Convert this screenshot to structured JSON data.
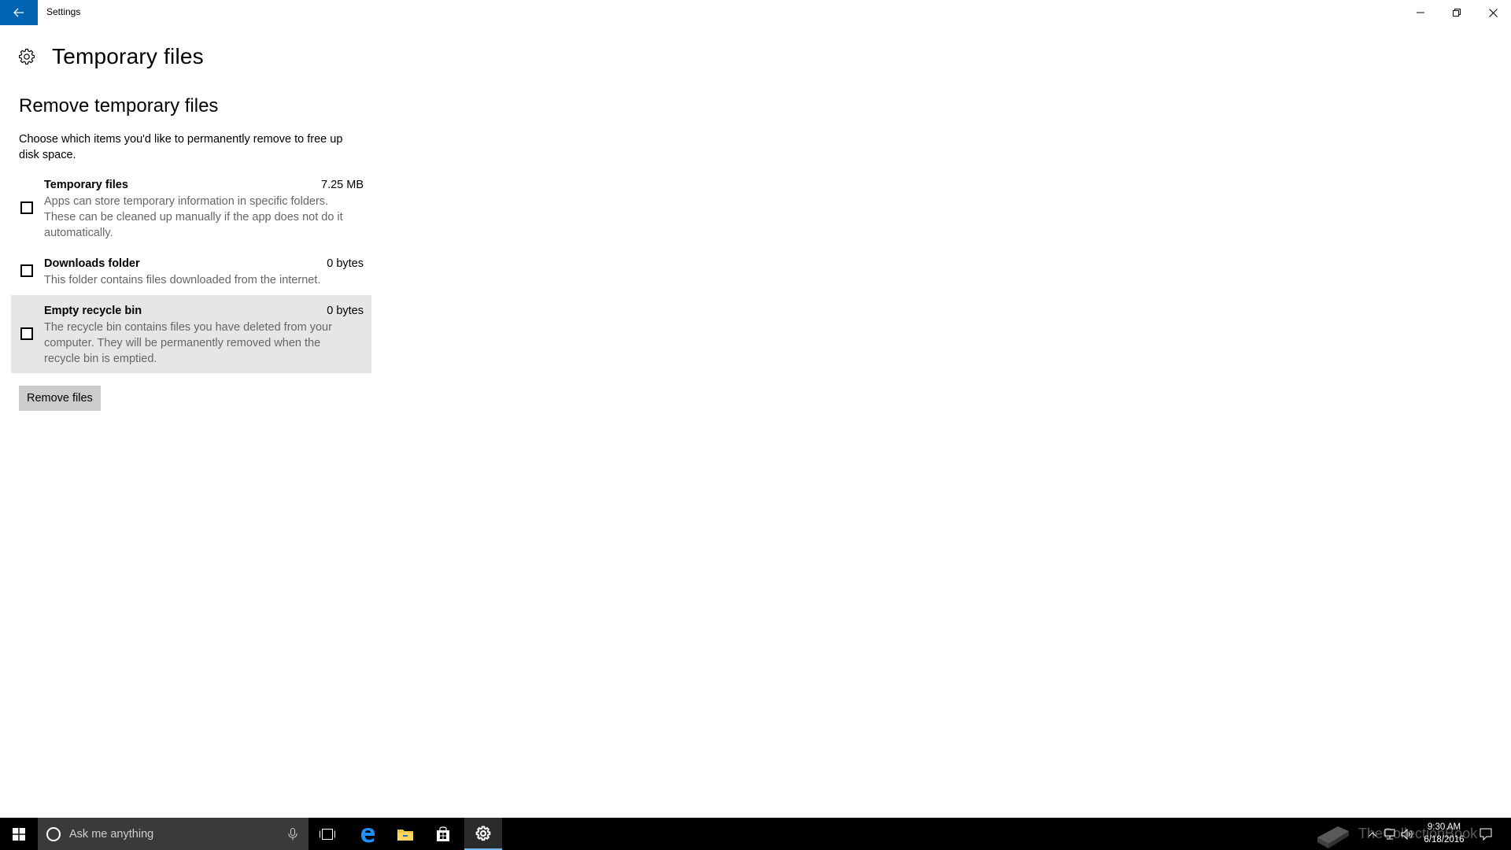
{
  "window": {
    "title": "Settings",
    "accent_color": "#0063b1"
  },
  "page": {
    "title": "Temporary files",
    "section_title": "Remove temporary files",
    "intro": "Choose which items you'd like to permanently remove to free up disk space."
  },
  "items": [
    {
      "name": "Temporary files",
      "size": "7.25 MB",
      "description": "Apps can store temporary information in specific folders. These can be cleaned up manually if the app does not do it automatically.",
      "checked": false
    },
    {
      "name": "Downloads folder",
      "size": "0 bytes",
      "description": "This folder contains files downloaded from the internet.",
      "checked": false
    },
    {
      "name": "Empty recycle bin",
      "size": "0 bytes",
      "description": "The recycle bin contains files you have deleted from your computer. They will be permanently removed when the recycle bin is emptied.",
      "checked": false
    }
  ],
  "remove_button": {
    "label": "Remove files"
  },
  "taskbar": {
    "search_placeholder": "Ask me anything",
    "clock_time": "9:30 AM",
    "clock_date": "6/18/2016",
    "icons": [
      "windows-start-icon",
      "cortana-circle-icon",
      "microphone-icon",
      "task-view-icon",
      "edge-icon",
      "file-explorer-icon",
      "store-icon",
      "settings-gear-icon",
      "chevron-up-icon",
      "network-icon",
      "volume-icon",
      "action-center-icon"
    ]
  },
  "watermark": {
    "text": "TheCollectionBook"
  }
}
